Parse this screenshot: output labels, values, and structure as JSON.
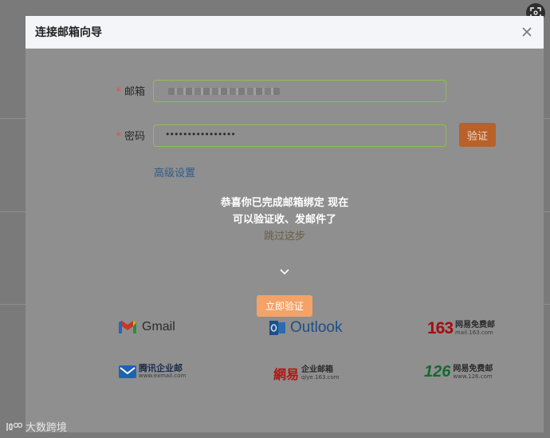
{
  "dialog": {
    "title": "连接邮箱向导"
  },
  "form": {
    "email_label": "邮箱",
    "password_label": "密码",
    "required_mark": "*",
    "password_value": "••••••••••••••••",
    "verify_button": "验证",
    "advanced_link": "高级设置"
  },
  "message": {
    "line1": "恭喜你已完成邮箱绑定 现在",
    "line2": "可以验证收、发邮件了",
    "skip": "跳过这步"
  },
  "start_button": "立即验证",
  "providers": {
    "gmail": "Gmail",
    "outlook": "Outlook",
    "p163_num": "163",
    "p163_cn": "网易免费邮",
    "p163_en": "mail.163.com",
    "tencent_cn": "腾讯企业邮",
    "tencent_en": "www.exmail.com",
    "wangyi_cn_big": "網易",
    "wangyi_cn": "企业邮箱",
    "wangyi_en": "qiye.163.com",
    "p126_num": "126",
    "p126_cn": "网易免费邮",
    "p126_en": "www.126.com"
  },
  "watermark": "大数跨境",
  "colors": {
    "accent_orange": "#f5a266",
    "verify_button": "#b8612a",
    "input_border": "#8bc34a",
    "link_blue": "#2f5d8c"
  },
  "icons": [
    "expand-icon",
    "close-icon",
    "chevron-down-icon",
    "gmail-logo",
    "outlook-logo",
    "tencent-logo",
    "watermark-logo"
  ]
}
